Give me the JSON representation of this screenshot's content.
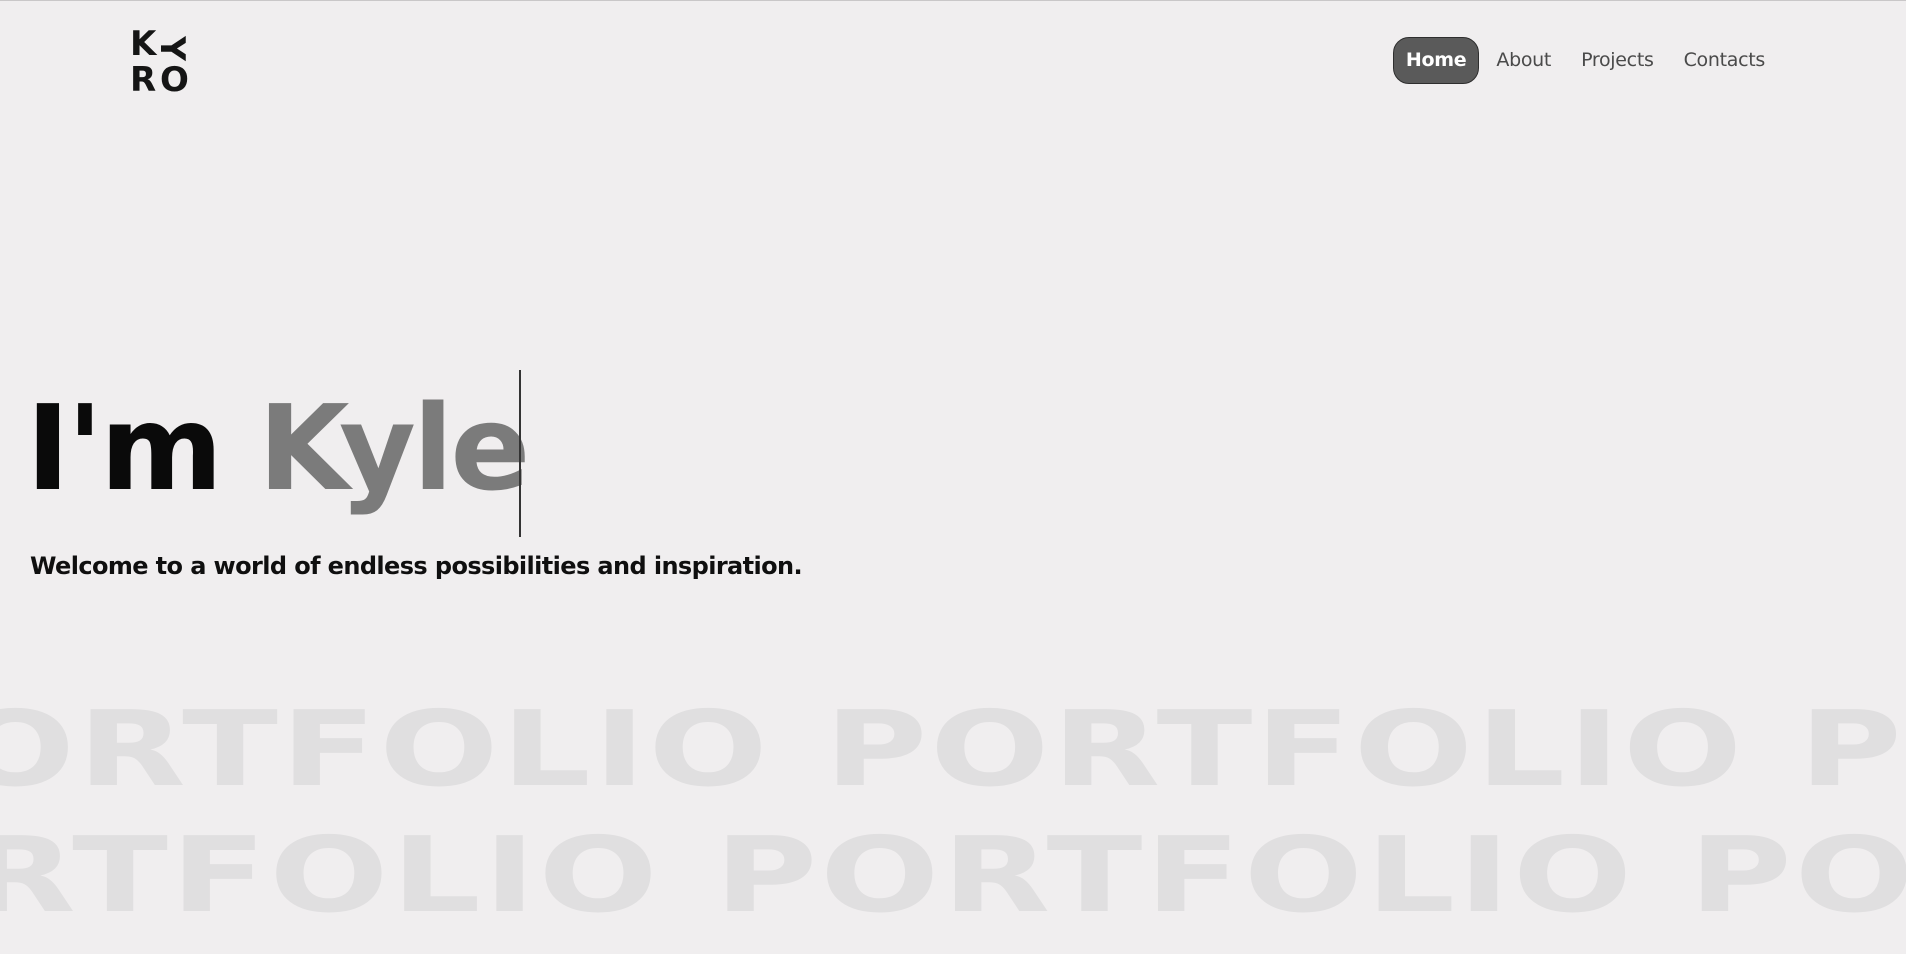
{
  "brand": {
    "logo_letters": [
      "K",
      "Y",
      "R",
      "O"
    ]
  },
  "nav": {
    "items": [
      {
        "label": "Home",
        "active": true
      },
      {
        "label": "About",
        "active": false
      },
      {
        "label": "Projects",
        "active": false
      },
      {
        "label": "Contacts",
        "active": false
      }
    ]
  },
  "hero": {
    "prefix": "I'm ",
    "name": "Kyle",
    "subtitle": "Welcome to a world of endless possibilities and inspiration."
  },
  "marquee": {
    "word": "PORTFOLIO",
    "row1": [
      "PORTFOLIO",
      "PORTFOLIO",
      "PORTFOLIO"
    ],
    "row2": [
      "PORTFOLIO",
      "PORTFOLIO",
      "PORTFOLIO"
    ]
  },
  "colors": {
    "background": "#f0eeef",
    "active_nav_bg": "#5a5a5a",
    "name_accent": "#7b7b7b",
    "marquee_text": "#e0dfe0"
  }
}
